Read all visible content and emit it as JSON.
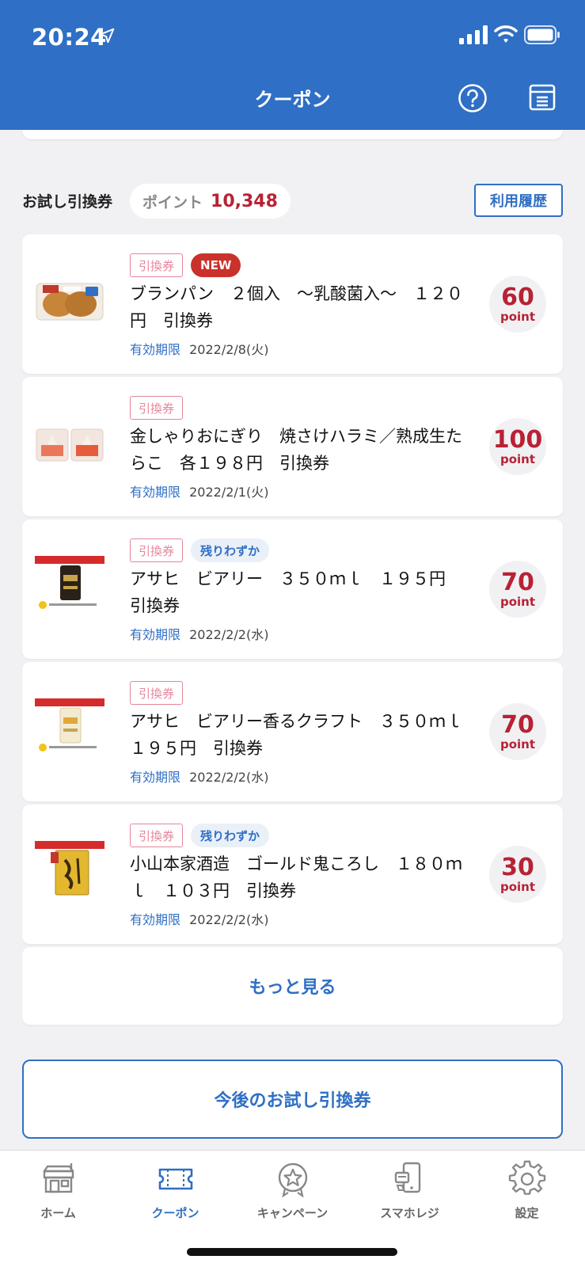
{
  "status_bar": {
    "time": "20:24"
  },
  "header": {
    "title": "クーポン",
    "help_icon": "help-circle-icon",
    "archive_icon": "archive-box-icon"
  },
  "section": {
    "label": "お試し引換券",
    "points_label": "ポイント",
    "points_value": "10,348",
    "history_button": "利用履歴"
  },
  "coupons": [
    {
      "type_badge": "引換券",
      "extra_badge": "NEW",
      "extra_kind": "new",
      "title": "ブランパン　２個入　〜乳酸菌入〜　１２０円　引換券",
      "expiry_label": "有効期限",
      "expiry_date": "2022/2/8(火)",
      "points": "60",
      "points_unit": "point",
      "image": "bread-package"
    },
    {
      "type_badge": "引換券",
      "extra_badge": "",
      "extra_kind": "",
      "title": "金しゃりおにぎり　焼さけハラミ／熟成生たらこ　各１９８円　引換券",
      "expiry_label": "有効期限",
      "expiry_date": "2022/2/1(火)",
      "points": "100",
      "points_unit": "point",
      "image": "onigiri-pair"
    },
    {
      "type_badge": "引換券",
      "extra_badge": "残りわずか",
      "extra_kind": "few",
      "title": "アサヒ　ビアリー　３５０ｍｌ　１９５円　引換券",
      "expiry_label": "有効期限",
      "expiry_date": "2022/2/2(水)",
      "points": "70",
      "points_unit": "point",
      "image": "beer-can-dark"
    },
    {
      "type_badge": "引換券",
      "extra_badge": "",
      "extra_kind": "",
      "title": "アサヒ　ビアリー香るクラフト　３５０ｍｌ　１９５円　引換券",
      "expiry_label": "有効期限",
      "expiry_date": "2022/2/2(水)",
      "points": "70",
      "points_unit": "point",
      "image": "beer-can-light"
    },
    {
      "type_badge": "引換券",
      "extra_badge": "残りわずか",
      "extra_kind": "few",
      "title": "小山本家酒造　ゴールド鬼ころし　１８０ｍｌ　１０３円　引換券",
      "expiry_label": "有効期限",
      "expiry_date": "2022/2/2(水)",
      "points": "30",
      "points_unit": "point",
      "image": "sake-pack"
    }
  ],
  "more_button": "もっと見る",
  "future_button": "今後のお試し引換券",
  "tabs": [
    {
      "label": "ホーム",
      "icon": "store-icon",
      "active": false
    },
    {
      "label": "クーポン",
      "icon": "ticket-icon",
      "active": true
    },
    {
      "label": "キャンペーン",
      "icon": "star-badge-icon",
      "active": false
    },
    {
      "label": "スマホレジ",
      "icon": "phone-register-icon",
      "active": false
    },
    {
      "label": "設定",
      "icon": "gear-icon",
      "active": false
    }
  ],
  "colors": {
    "brand": "#2f6fc5",
    "points_red": "#b82234",
    "new_badge": "#c9312a"
  }
}
